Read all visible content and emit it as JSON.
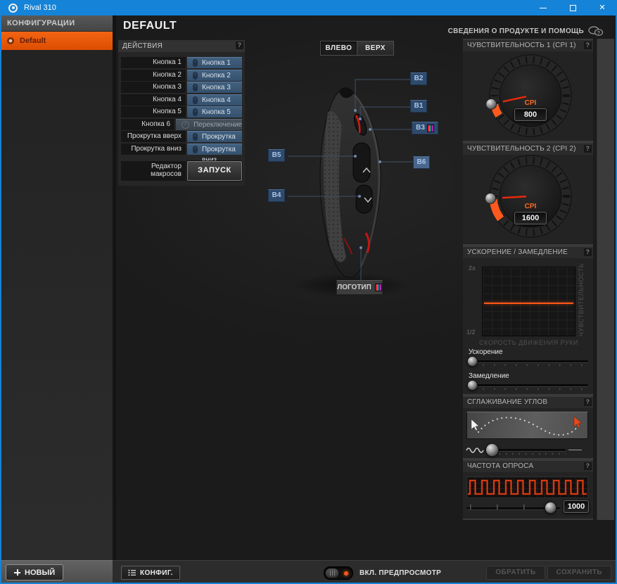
{
  "window": {
    "title": "Rival 310"
  },
  "sidebar": {
    "header": "КОНФИГУРАЦИИ",
    "items": [
      {
        "label": "Default",
        "selected": true
      }
    ],
    "new_button": "НОВЫЙ"
  },
  "main": {
    "profile_title": "DEFAULT",
    "help_link": "СВЕДЕНИЯ О ПРОДУКТЕ И ПОМОЩЬ",
    "view_buttons": [
      {
        "label": "ВЛЕВО",
        "active": true
      },
      {
        "label": "ВЕРХ",
        "active": false
      }
    ]
  },
  "actions": {
    "title": "ДЕЙСТВИЯ",
    "rows": [
      {
        "label": "Кнопка 1",
        "binding": "Кнопка 1"
      },
      {
        "label": "Кнопка 2",
        "binding": "Кнопка 2"
      },
      {
        "label": "Кнопка 3",
        "binding": "Кнопка 3"
      },
      {
        "label": "Кнопка 4",
        "binding": "Кнопка 4"
      },
      {
        "label": "Кнопка 5",
        "binding": "Кнопка 5"
      },
      {
        "label": "Кнопка 6",
        "binding": "Переключение CPI"
      },
      {
        "label": "Прокрутка вверх",
        "binding": "Прокрутка вверх"
      },
      {
        "label": "Прокрутка вниз",
        "binding": "Прокрутка вниз"
      }
    ],
    "macro_label_line1": "Редактор",
    "macro_label_line2": "макросов",
    "macro_button": "ЗАПУСК"
  },
  "mouse_map": {
    "labels": {
      "b1": "B1",
      "b2": "B2",
      "b3": "B3",
      "b4": "B4",
      "b5": "B5",
      "b6": "B6",
      "logo": "ЛОГОТИП"
    }
  },
  "cpi1": {
    "title": "ЧУВСТВИТЕЛЬНОСТЬ 1 (CPI 1)",
    "unit": "CPI",
    "value": "800"
  },
  "cpi2": {
    "title": "ЧУВСТВИТЕЛЬНОСТЬ 2 (CPI 2)",
    "unit": "CPI",
    "value": "1600"
  },
  "accel": {
    "title": "УСКОРЕНИЕ / ЗАМЕДЛЕНИЕ",
    "y_max": "2x",
    "y_min": "1/2",
    "y_axis": "ЧУВСТВИТЕЛЬНОСТЬ",
    "x_axis": "СКОРОСТЬ ДВИЖЕНИЯ РУКИ",
    "slider1_label": "Ускорение",
    "slider2_label": "Замедление"
  },
  "smoothing": {
    "title": "СГЛАЖИВАНИЕ УГЛОВ"
  },
  "polling": {
    "title": "ЧАСТОТА ОПРОСА",
    "value": "1000"
  },
  "footer": {
    "config_button": "КОНФИГ.",
    "preview_label": "ВКЛ. ПРЕДПРОСМОТР",
    "preview_on": true,
    "revert_button": "ОБРАТИТЬ",
    "save_button": "СОХРАНИТЬ"
  },
  "ui": {
    "help_badge": "?"
  },
  "colors": {
    "accent": "#ff5a1e",
    "titlebar": "#1583d7",
    "action_blue": "#34506e",
    "config_selected": "#e85505"
  }
}
